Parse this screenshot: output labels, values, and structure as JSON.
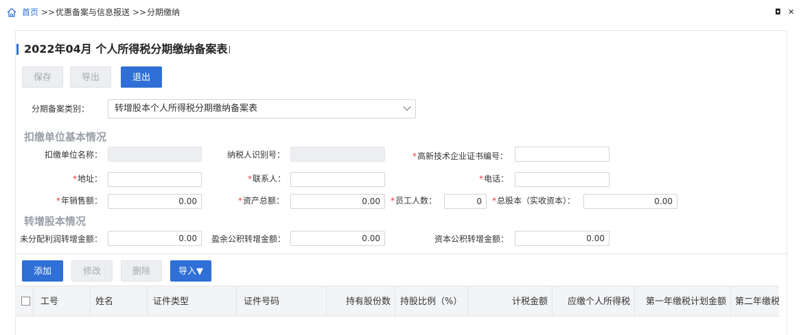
{
  "breadcrumb": {
    "home": "首页",
    "sep1": ">>",
    "section": "优惠备案与信息报送",
    "sep2": ">>",
    "current": "分期缴纳"
  },
  "window_controls": {
    "restore": "◘",
    "close": "✕"
  },
  "page_title": "2022年04月  个人所得税分期缴纳备案表",
  "toolbar": {
    "save": "保存",
    "export": "导出",
    "exit": "退出"
  },
  "category": {
    "label": "分期备案类别：",
    "selected": "转增股本个人所得税分期缴纳备案表"
  },
  "section_basic": "扣缴单位基本情况",
  "basic": {
    "unit_name_label": "扣缴单位名称：",
    "unit_name_value": "",
    "taxpayer_id_label": "纳税人识别号：",
    "taxpayer_id_value": "",
    "cert_no_label": "高新技术企业证书编号：",
    "cert_no_value": "",
    "address_label": "地址：",
    "address_value": "",
    "contact_label": "联系人：",
    "contact_value": "",
    "phone_label": "电话：",
    "phone_value": "",
    "annual_sales_label": "年销售额：",
    "annual_sales_value": "0.00",
    "total_assets_label": "资产总额：",
    "total_assets_value": "0.00",
    "employees_label": "员工人数：",
    "employees_value": "0",
    "total_capital_label": "总股本（实收资本）：",
    "total_capital_value": "0.00"
  },
  "section_capital": "转增股本情况",
  "capital": {
    "undistributed_label": "未分配利润转增金额：",
    "undistributed_value": "0.00",
    "surplus_label": "盈余公积转增金额：",
    "surplus_value": "0.00",
    "capital_reserve_label": "资本公积转增金额：",
    "capital_reserve_value": "0.00"
  },
  "table_toolbar": {
    "add": "添加",
    "edit": "修改",
    "delete": "删除",
    "import": "导入▼"
  },
  "table": {
    "columns": [
      "工号",
      "姓名",
      "证件类型",
      "证件号码",
      "持有股份数",
      "持股比例（%）",
      "计税金额",
      "应缴个人所得税",
      "第一年缴税计划金额",
      "第二年缴税"
    ]
  },
  "colors": {
    "accent": "#2f6fd6",
    "required": "#e53935",
    "section_gray": "#9aa0a8"
  }
}
